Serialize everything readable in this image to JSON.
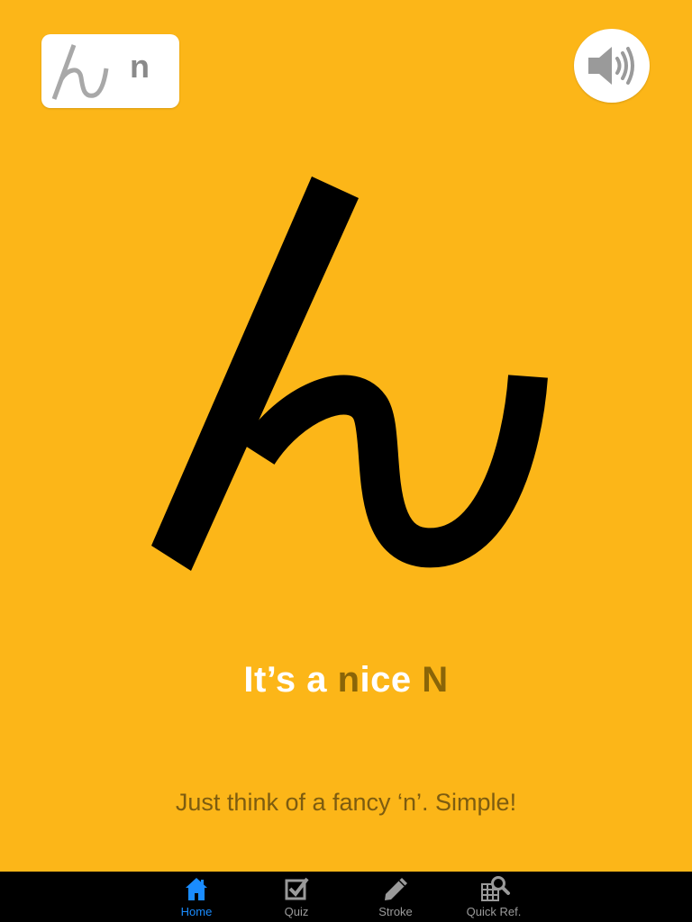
{
  "letter_card": {
    "fancy_glyph": "h",
    "plain_letter": "n"
  },
  "sound_button": {
    "icon": "speaker-icon"
  },
  "main_glyph": {
    "icon": "fancy-n-glyph",
    "color": "#000000"
  },
  "headline": {
    "part1": "It’s a ",
    "part2": "n",
    "part3": "ice ",
    "part4": "N"
  },
  "hint": "Just think of a fancy ‘n’. Simple!",
  "tabbar": {
    "items": [
      {
        "label": "Home",
        "icon": "home-icon",
        "active": true
      },
      {
        "label": "Quiz",
        "icon": "checkbox-icon",
        "active": false
      },
      {
        "label": "Stroke",
        "icon": "pencil-icon",
        "active": false
      },
      {
        "label": "Quick Ref.",
        "icon": "grid-search-icon",
        "active": false
      }
    ]
  },
  "colors": {
    "background": "#FCB618",
    "headline_white": "#ffffff",
    "headline_accent": "#8a6508",
    "hint_text": "#7d5c10",
    "tab_active": "#1a8cff",
    "tab_inactive": "#9a9a9a"
  }
}
